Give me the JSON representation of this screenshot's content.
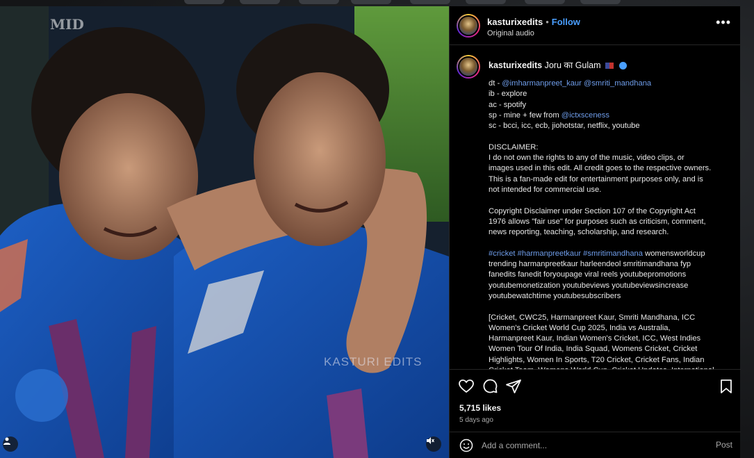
{
  "post": {
    "username": "kasturixedits",
    "follow_label": "Follow",
    "audio_label": "Original audio",
    "more_label": "•••"
  },
  "media": {
    "watermark": "KASTURI EDITS",
    "logo_text": "MID",
    "sound_icon": "speaker-muted-icon",
    "user_icon": "person-icon"
  },
  "caption": {
    "username": "kasturixedits",
    "title": "Joru का Gulam",
    "lines": [
      {
        "parts": [
          {
            "t": "dt - ",
            "link": false
          },
          {
            "t": "@imharmanpreet_kaur @smriti_mandhana",
            "link": true
          }
        ]
      },
      {
        "parts": [
          {
            "t": "ib - explore",
            "link": false
          }
        ]
      },
      {
        "parts": [
          {
            "t": "ac - spotify",
            "link": false
          }
        ]
      },
      {
        "parts": [
          {
            "t": "sp - mine + few from ",
            "link": false
          },
          {
            "t": "@ictxsceness",
            "link": true
          }
        ]
      },
      {
        "parts": [
          {
            "t": "sc - bcci, icc, ecb, jiohotstar, netflix, youtube",
            "link": false
          }
        ]
      },
      {
        "gap": true
      },
      {
        "parts": [
          {
            "t": "DISCLAIMER:",
            "link": false
          }
        ]
      },
      {
        "parts": [
          {
            "t": "I do not own the rights to any of the music, video clips, or",
            "link": false
          }
        ]
      },
      {
        "parts": [
          {
            "t": "images used in this edit. All credit goes to the respective owners.",
            "link": false
          }
        ]
      },
      {
        "parts": [
          {
            "t": "This is a fan-made edit for entertainment purposes only, and is",
            "link": false
          }
        ]
      },
      {
        "parts": [
          {
            "t": "not intended for commercial use.",
            "link": false
          }
        ]
      },
      {
        "gap": true
      },
      {
        "parts": [
          {
            "t": "Copyright Disclaimer under Section 107 of the Copyright Act",
            "link": false
          }
        ]
      },
      {
        "parts": [
          {
            "t": "1976 allows \"fair use\" for purposes such as criticism, comment,",
            "link": false
          }
        ]
      },
      {
        "parts": [
          {
            "t": "news reporting, teaching, scholarship, and research.",
            "link": false
          }
        ]
      },
      {
        "gap": true
      },
      {
        "parts": [
          {
            "t": "#cricket #harmanpreetkaur #smritimandhana",
            "link": true
          },
          {
            "t": " womensworldcup",
            "link": false
          }
        ]
      },
      {
        "parts": [
          {
            "t": "trending harmanpreetkaur harleendeol smritimandhana fyp",
            "link": false
          }
        ]
      },
      {
        "parts": [
          {
            "t": "fanedits fanedit foryoupage viral reels youtubepromotions",
            "link": false
          }
        ]
      },
      {
        "parts": [
          {
            "t": "youtubemonetization youtubeviews youtubeviewsincrease",
            "link": false
          }
        ]
      },
      {
        "parts": [
          {
            "t": "youtubewatchtime youtubesubscribers",
            "link": false
          }
        ]
      },
      {
        "gap": true
      },
      {
        "parts": [
          {
            "t": "[Cricket, CWC25, Harmanpreet Kaur, Smriti Mandhana, ICC",
            "link": false
          }
        ]
      },
      {
        "parts": [
          {
            "t": "Women's Cricket World Cup 2025, India vs Australia,",
            "link": false
          }
        ]
      },
      {
        "parts": [
          {
            "t": "Harmanpreet Kaur, Indian Women's Cricket, ICC, West Indies",
            "link": false
          }
        ]
      },
      {
        "parts": [
          {
            "t": "Women Tour Of India, India Squad, Womens Cricket, Cricket",
            "link": false
          }
        ]
      },
      {
        "parts": [
          {
            "t": "Highlights, Women In Sports, T20 Cricket, Cricket Fans, Indian",
            "link": false
          }
        ]
      },
      {
        "parts": [
          {
            "t": "Cricket Team, Womens World Cup, Cricket Updates, International",
            "link": false
          }
        ]
      }
    ]
  },
  "actions": {
    "likes": "5,715 likes",
    "posted_ago": "5 days ago",
    "icons": [
      "heart-icon",
      "comment-icon",
      "share-icon",
      "bookmark-icon"
    ]
  },
  "comment": {
    "placeholder": "Add a comment...",
    "post_label": "Post"
  },
  "colors": {
    "panel_bg": "#000000",
    "link": "#6f9dea",
    "follow": "#4a9fff",
    "muted_text": "#a8a8a8"
  }
}
